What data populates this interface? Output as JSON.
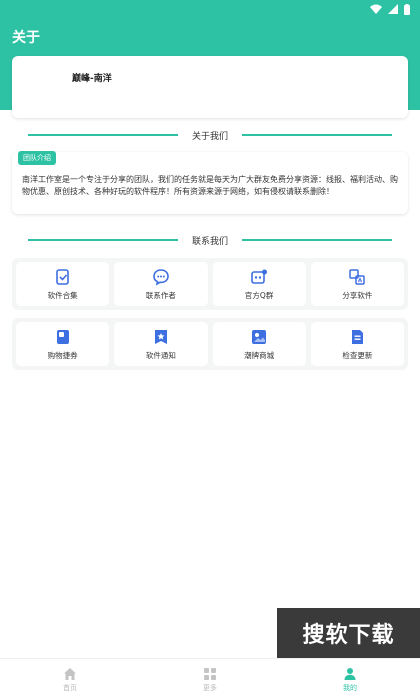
{
  "app": {
    "title": "关于"
  },
  "profile": {
    "name": "巅峰-南洋"
  },
  "about_section": {
    "heading": "关于我们",
    "badge": "团队介绍",
    "text": "南洋工作室是一个专注于分享的团队，我们的任务就是每天为广大群友免费分享资源：线报、福利活动、购物优惠、原创技术、各种好玩的软件程序！所有资源来源于网络，如有侵权请联系删除！"
  },
  "contact_section": {
    "heading": "联系我们",
    "row1": [
      {
        "label": "软件合集",
        "icon": "collection-icon"
      },
      {
        "label": "联系作者",
        "icon": "chat-icon"
      },
      {
        "label": "官方Q群",
        "icon": "group-icon"
      },
      {
        "label": "分享软件",
        "icon": "translate-icon"
      }
    ],
    "row2": [
      {
        "label": "购物捷券",
        "icon": "coupon-icon"
      },
      {
        "label": "软件通知",
        "icon": "star-bookmark-icon"
      },
      {
        "label": "潮牌商城",
        "icon": "image-icon"
      },
      {
        "label": "检查更新",
        "icon": "document-icon"
      }
    ]
  },
  "watermark": {
    "text": "搜软下载"
  },
  "tabbar": {
    "tabs": [
      {
        "label": "首页",
        "icon": "home-icon"
      },
      {
        "label": "更多",
        "icon": "grid-icon"
      },
      {
        "label": "我的",
        "icon": "person-icon"
      }
    ],
    "active_index": 2
  },
  "colors": {
    "accent": "#2ec2a4",
    "icon_blue": "#3d6fe0",
    "watermark_bg": "#3a3a3a"
  }
}
